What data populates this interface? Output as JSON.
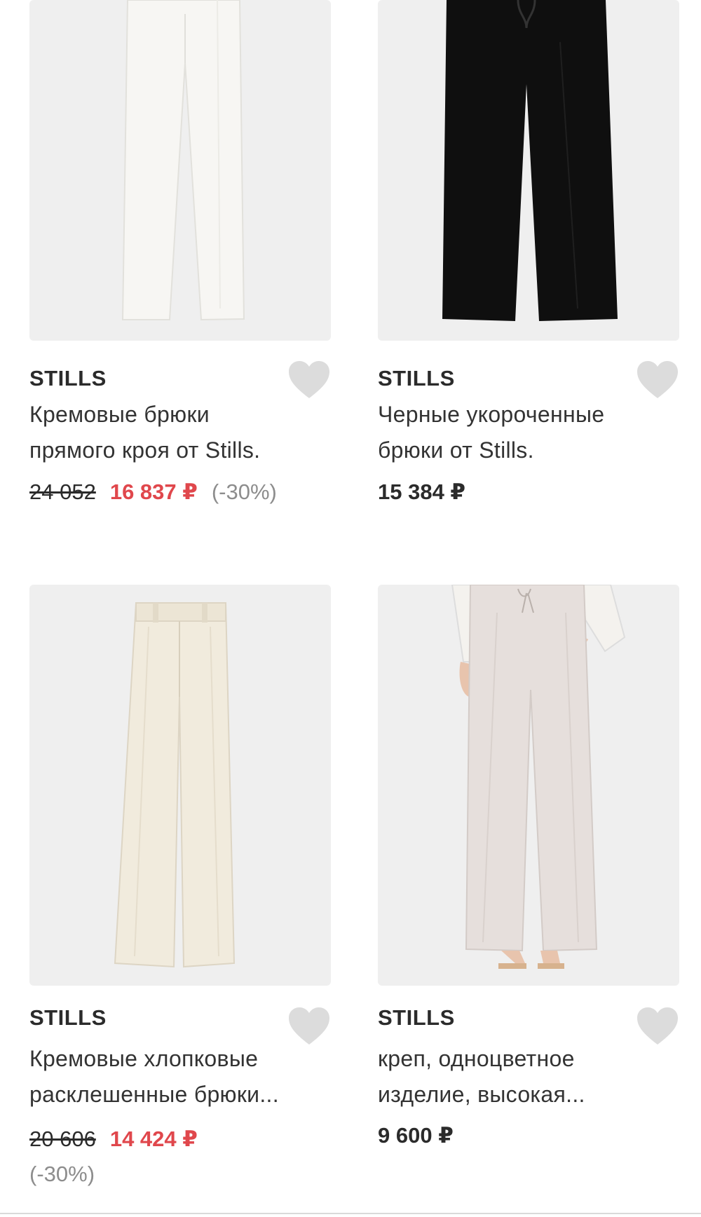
{
  "products": [
    {
      "brand": "STILLS",
      "title_line1": "Кремовые брюки",
      "title_line2": "прямого кроя от Stills.",
      "old_price": "24 052",
      "new_price": "16 837 ₽",
      "discount": "(-30%)",
      "image_color": "#f4f3ef",
      "favorite_icon": "heart-icon"
    },
    {
      "brand": "STILLS",
      "title_line1": "Черные укороченные",
      "title_line2": "брюки от Stills.",
      "price": "15 384 ₽",
      "image_color": "#111111",
      "favorite_icon": "heart-icon"
    },
    {
      "brand": "STILLS",
      "title_line1": "Кремовые хлопковые",
      "title_line2": "расклешенные брюки...",
      "old_price": "20 606",
      "new_price": "14 424 ₽",
      "discount": "(-30%)",
      "image_color": "#f1ebdd",
      "favorite_icon": "heart-icon"
    },
    {
      "brand": "STILLS",
      "title_line1": "креп, одноцветное",
      "title_line2": "изделие, высокая...",
      "price": "9 600 ₽",
      "image_color": "#e6dfdc",
      "favorite_icon": "heart-icon"
    }
  ],
  "colors": {
    "sale_price": "#e0474c",
    "discount": "#8d8d8d",
    "card_background": "#efefef",
    "heart": "#dcdcdc"
  }
}
